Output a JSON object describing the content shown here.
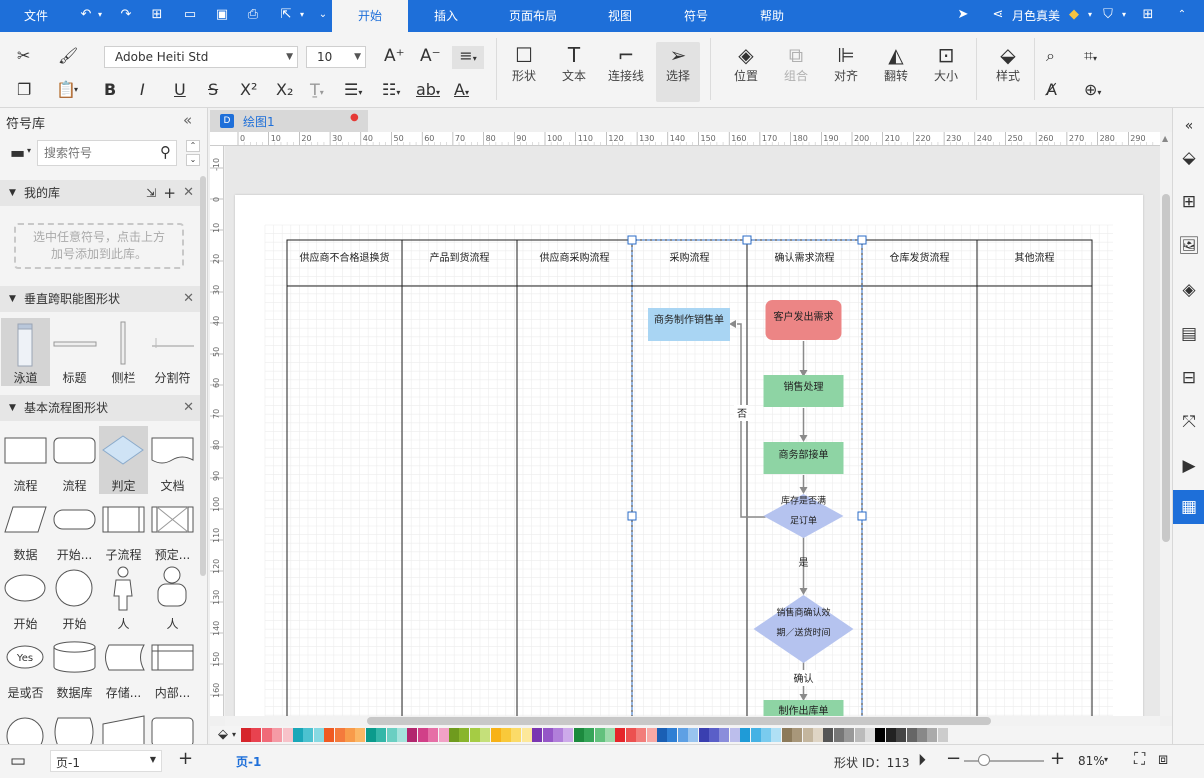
{
  "menubar": {
    "file": "文件",
    "tabs": [
      "开始",
      "插入",
      "页面布局",
      "视图",
      "符号",
      "帮助"
    ],
    "active_tab": "开始",
    "user": "月色真美"
  },
  "ribbon": {
    "font_name": "Adobe Heiti Std",
    "font_size": "10",
    "big_buttons": [
      {
        "label": "形状",
        "icon": "square-icon"
      },
      {
        "label": "文本",
        "icon": "text-icon"
      },
      {
        "label": "连接线",
        "icon": "connector-icon"
      },
      {
        "label": "选择",
        "icon": "select-icon"
      },
      {
        "label": "位置",
        "icon": "layers-icon"
      },
      {
        "label": "组合",
        "icon": "group-icon"
      },
      {
        "label": "对齐",
        "icon": "align-icon"
      },
      {
        "label": "翻转",
        "icon": "flip-icon"
      },
      {
        "label": "大小",
        "icon": "size-icon"
      },
      {
        "label": "样式",
        "icon": "style-icon"
      }
    ]
  },
  "library": {
    "title": "符号库",
    "search_placeholder": "搜索符号",
    "my_lib": {
      "title": "我的库",
      "hint": "选中任意符号，点击上方加号添加到此库。"
    },
    "swimlane": {
      "title": "垂直跨职能图形状",
      "items": [
        "泳道",
        "标题",
        "侧栏",
        "分割符"
      ]
    },
    "flow": {
      "title": "基本流程图形状",
      "items": [
        "流程",
        "流程",
        "判定",
        "文档",
        "数据",
        "开始...",
        "子流程",
        "预定...",
        "开始",
        "开始",
        "人",
        "人",
        "是或否",
        "数据库",
        "存储...",
        "内部..."
      ],
      "yes_text": "Yes"
    }
  },
  "doc": {
    "tab_name": "绘图1",
    "ruler_top": [
      "0",
      "10",
      "20",
      "30",
      "40",
      "50",
      "60",
      "70",
      "80",
      "90",
      "100",
      "110",
      "120",
      "130",
      "140",
      "150",
      "160",
      "170",
      "180",
      "190",
      "200",
      "210",
      "220",
      "230",
      "240",
      "250",
      "260",
      "270",
      "280",
      "290"
    ],
    "ruler_left": [
      "-10",
      "0",
      "10",
      "20",
      "30",
      "40",
      "50",
      "60",
      "70",
      "80",
      "90",
      "100",
      "110",
      "120",
      "130",
      "140",
      "150",
      "160"
    ]
  },
  "diagram": {
    "lanes": [
      "供应商不合格退换货",
      "产品到货流程",
      "供应商采购流程",
      "采购流程",
      "确认需求流程",
      "仓库发货流程",
      "其他流程"
    ],
    "nodes": {
      "n1": "客户发出需求",
      "n2": "销售处理",
      "n3": "商务部接单",
      "n4a": "库存是否满",
      "n4b": "足订单",
      "n5": "商务制作销售单",
      "n6a": "销售商确认效",
      "n6b": "期／送货时间",
      "n7": "制作出库单"
    },
    "labels": {
      "no": "否",
      "yes": "是",
      "confirm": "确认"
    },
    "colors": {
      "red": "#ec8585",
      "green": "#8ed4a4",
      "blue_light": "#a9d5f3",
      "diamond": "#b5c3ef"
    }
  },
  "status": {
    "page_select": "页-1",
    "page_tab": "页-1",
    "shape_id": "形状 ID：113",
    "zoom": "81%"
  },
  "palette": [
    "#d6252b",
    "#e8424f",
    "#f06a78",
    "#f59aa5",
    "#f7c2c9",
    "#1aa7b8",
    "#4cc2d0",
    "#86d9e2",
    "#f05a22",
    "#f47a3c",
    "#f89b4a",
    "#fbb765",
    "#0b9b8c",
    "#34b7a8",
    "#6bcfc2",
    "#a5e3dc",
    "#b2266e",
    "#d14088",
    "#e66fa6",
    "#f2a2c6",
    "#6f9b1e",
    "#89b52c",
    "#a5cc44",
    "#c5e07a",
    "#f7b217",
    "#f9c93a",
    "#fbdb68",
    "#fde89a",
    "#7a36b1",
    "#9556c7",
    "#b17fda",
    "#cdaaea",
    "#1c8a3e",
    "#35a558",
    "#62c17d",
    "#9cdaab",
    "#e6252a",
    "#ec5150",
    "#f27d7a",
    "#f7a9a6",
    "#1a5fb4",
    "#2f7fd4",
    "#5ea0e4",
    "#98c4ef",
    "#3a3fb0",
    "#5a5fc8",
    "#8a8ddb",
    "#bcbeec",
    "#1f9bd7",
    "#45b2e4",
    "#7acbee",
    "#b0e0f5",
    "#8c7a5a",
    "#a8977a",
    "#c4b69e",
    "#dfd5c5",
    "#555555",
    "#777777",
    "#999999",
    "#bbbbbb",
    "#dddddd",
    "#000000",
    "#222222",
    "#444444",
    "#666666",
    "#888888",
    "#aaaaaa",
    "#cccccc"
  ]
}
